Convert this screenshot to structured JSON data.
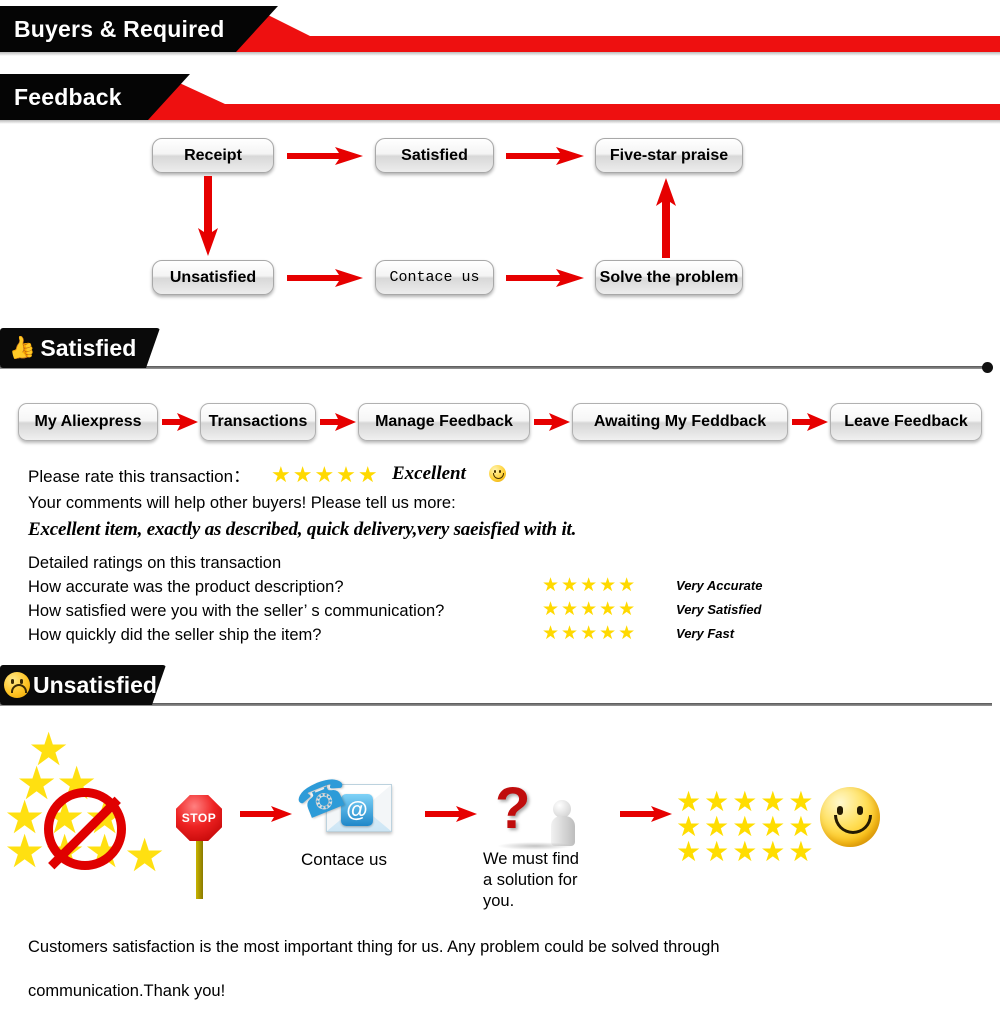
{
  "banners": {
    "buyers": "Buyers & Required",
    "feedback": "Feedback"
  },
  "sections": {
    "satisfied": {
      "label": "Satisfied",
      "icon": "thumbs-up-icon"
    },
    "unsatisfied": {
      "label": "Unsatisfied",
      "icon": "sad-face-icon"
    }
  },
  "flowchart": {
    "nodes": {
      "receipt": "Receipt",
      "satisfied": "Satisfied",
      "five_star": "Five-star praise",
      "unsatisfied": "Unsatisfied",
      "contact": "Contace us",
      "solve": "Solve the problem"
    }
  },
  "breadcrumb": {
    "items": [
      "My Aliexpress",
      "Transactions",
      "Manage Feedback",
      "Awaiting My Feddback",
      "Leave Feedback"
    ]
  },
  "rating": {
    "prompt": "Please rate this transaction",
    "colon": "：",
    "stars": "★★★★★",
    "verdict": "Excellent",
    "comments_hint": "Your comments will help other buyers! Please tell us more:",
    "comment": "Excellent item, exactly as described, quick delivery,very saeisfied with it.",
    "detailed_title": "Detailed ratings on this transaction",
    "rows": [
      {
        "question": "How accurate was the product description?",
        "stars": "★★★★★",
        "verdict": "Very Accurate"
      },
      {
        "question": "How satisfied were you with the seller’ s communication?",
        "stars": "★★★★★",
        "verdict": "Very Satisfied"
      },
      {
        "question": "How quickly did the seller ship the item?",
        "stars": "★★★★★",
        "verdict": "Very Fast"
      }
    ]
  },
  "unsatisfied_flow": {
    "stop_label": "STOP",
    "contact_label": "Contace us",
    "solution_label": "We must find\na solution for\nyou.",
    "solution_line1": "We must find",
    "solution_line2": "a solution for",
    "solution_line3": "you.",
    "at_symbol": "@",
    "question_mark": "?",
    "star_rows": [
      "★★★★★",
      "★★★★★",
      "★★★★★"
    ]
  },
  "footer": {
    "line1": "Customers satisfaction is the most important thing for us. Any problem could be solved through",
    "line2": "communication.Thank you!"
  },
  "colors": {
    "banner_red": "#ee1010",
    "banner_black": "#050505",
    "star_yellow": "#ffd900",
    "arrow_red": "#e60000"
  }
}
